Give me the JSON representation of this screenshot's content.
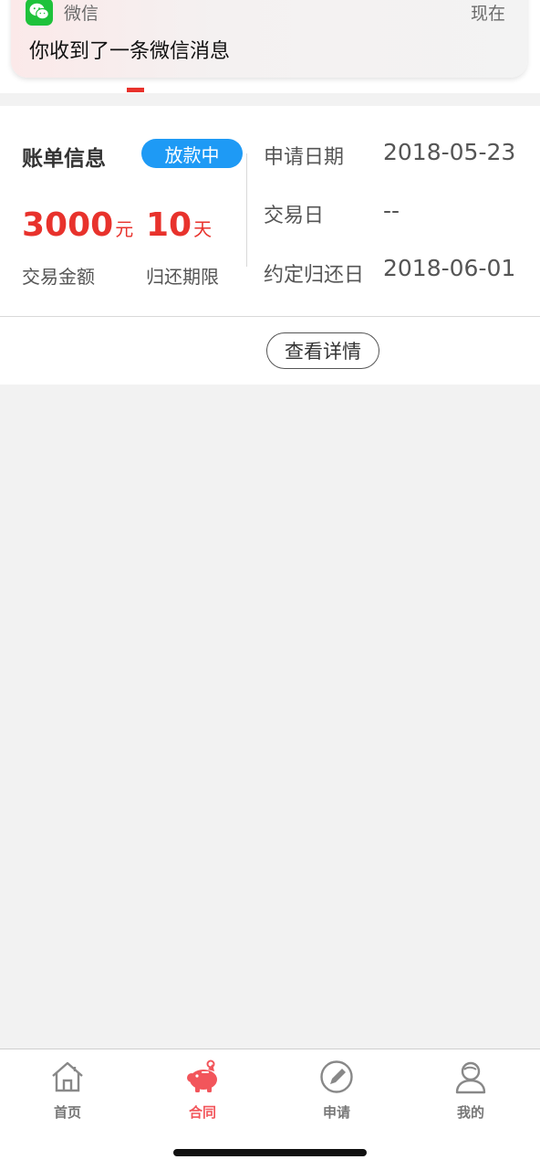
{
  "notification": {
    "app_name": "微信",
    "time": "现在",
    "message": "你收到了一条微信消息"
  },
  "bill": {
    "title": "账单信息",
    "status": "放款中",
    "amount": "3000",
    "amount_unit": "元",
    "amount_label": "交易金额",
    "term": "10",
    "term_unit": "天",
    "term_label": "归还期限",
    "fields": [
      {
        "label": "申请日期",
        "value": "2018-05-23"
      },
      {
        "label": "交易日",
        "value": "--"
      },
      {
        "label": "约定归还日",
        "value": "2018-06-01"
      }
    ],
    "detail_button": "查看详情"
  },
  "tabbar": {
    "items": [
      {
        "label": "首页",
        "icon": "home-icon"
      },
      {
        "label": "合同",
        "icon": "piggy-bank-icon"
      },
      {
        "label": "申请",
        "icon": "pencil-circle-icon"
      },
      {
        "label": "我的",
        "icon": "user-icon"
      }
    ],
    "active_index": 1
  },
  "colors": {
    "accent_red": "#e8322c",
    "badge_blue": "#1e9af5",
    "active_tab": "#f2555b",
    "wechat_green": "#1ec23b"
  }
}
